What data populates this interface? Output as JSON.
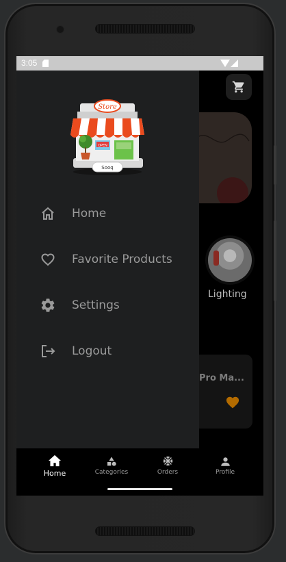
{
  "status_bar": {
    "time": "3:05"
  },
  "background": {
    "cart_icon": "cart-icon",
    "category_label": "Lighting",
    "product_name": "Pro Ma...",
    "favorite_icon": "heart-filled-icon",
    "favorite_color": "#b36b00"
  },
  "drawer": {
    "logo": {
      "sign_text": "Store",
      "open_text": "OPEN",
      "brand_text": "Sooq"
    },
    "items": [
      {
        "label": "Home",
        "icon": "home-icon"
      },
      {
        "label": "Favorite Products",
        "icon": "heart-outline-icon"
      },
      {
        "label": "Settings",
        "icon": "gear-icon"
      },
      {
        "label": "Logout",
        "icon": "logout-icon"
      }
    ]
  },
  "bottom_nav": {
    "active": "Home",
    "items": [
      {
        "label": "Home",
        "icon": "home-icon"
      },
      {
        "label": "Categories",
        "icon": "categories-icon"
      },
      {
        "label": "Orders",
        "icon": "snowflake-icon"
      },
      {
        "label": "Profile",
        "icon": "person-icon"
      }
    ]
  },
  "colors": {
    "drawer_bg": "#1e1f20",
    "text_muted": "#9a9a9a",
    "accent": "#b36b00"
  }
}
